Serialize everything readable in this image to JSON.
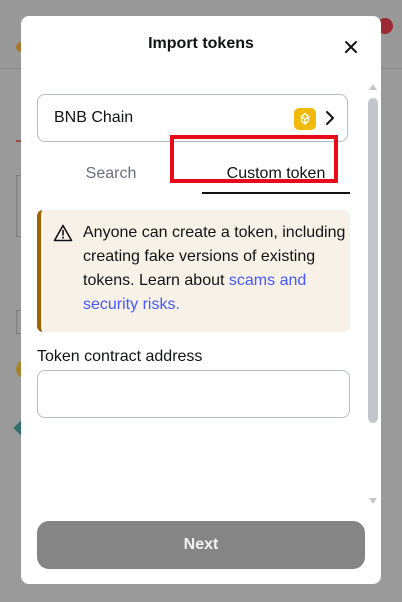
{
  "modal": {
    "title": "Import tokens",
    "network": {
      "name": "BNB Chain"
    },
    "tabs": [
      {
        "label": "Search",
        "active": false
      },
      {
        "label": "Custom token",
        "active": true
      }
    ],
    "warning": {
      "text": "Anyone can create a token, including creating fake versions of existing tokens. Learn about",
      "link_text": "scams and security risks."
    },
    "address_field": {
      "label": "Token contract address",
      "value": "",
      "placeholder": ""
    },
    "next_button": {
      "label": "Next"
    }
  },
  "colors": {
    "accent_link": "#4459ff",
    "warning_border": "#9a6300",
    "warning_bg": "#f8f1e8",
    "disabled_button": "#858585",
    "highlight": "#e8091b",
    "bnb_brand": "#f0b90b"
  },
  "icons": [
    "close-icon",
    "bnb-chain-icon",
    "chevron-right-icon",
    "warning-icon"
  ]
}
